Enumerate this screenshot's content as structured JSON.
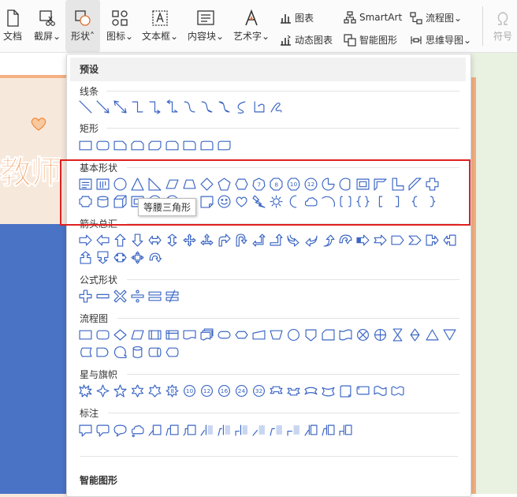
{
  "toolbar": {
    "doc_label": "文档",
    "screenshot_label": "截屏",
    "shape_label": "形状",
    "icon_label": "图标",
    "textbox_label": "文本框",
    "content_block_label": "内容块",
    "wordart_label": "艺术字",
    "chart_label": "图表",
    "dynamic_chart_label": "动态图表",
    "smartart_label": "SmartArt",
    "smart_graphic_label": "智能图形",
    "flowchart_label": "流程图",
    "mindmap_label": "思维导图",
    "symbol_label": "符号",
    "dropdown_glyph": "⌄",
    "caret_up": "˄"
  },
  "background": {
    "slide_title": "教师"
  },
  "shape_panel": {
    "header": "预设",
    "sections": {
      "lines": "线条",
      "rectangles": "矩形",
      "basic": "基本形状",
      "arrows": "箭头总汇",
      "equation": "公式形状",
      "flowchart": "流程图",
      "stars": "星与旗帜",
      "callouts": "标注"
    },
    "tooltip": "等腰三角形",
    "smart_section": "智能图形"
  },
  "colors": {
    "accent_blue": "#3b66c4",
    "highlight_red": "#e02020",
    "slide_orange": "#f08a3c"
  }
}
